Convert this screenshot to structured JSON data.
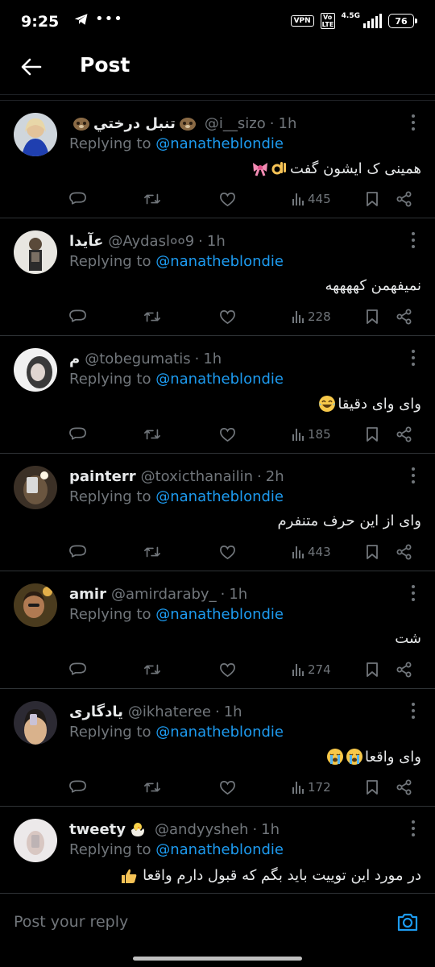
{
  "status_bar": {
    "time": "9:25",
    "vpn": "VPN",
    "network": "4.5G",
    "volte": "Vo LTE",
    "battery": "76"
  },
  "header": {
    "title": "Post"
  },
  "replying_to_prefix": "Replying to",
  "replies": [
    {
      "display_name": "تنبل درختي",
      "handle": "@i__sizo",
      "time": "1h",
      "replying_to": "@nanatheblondie",
      "text": "همینی ک ایشون گفت",
      "views": "445",
      "emoji_before_name": "sloth-emoji",
      "emoji_after_name": "sloth-emoji",
      "text_emojis": [
        "ok-hand-emoji",
        "ribbon-emoji"
      ]
    },
    {
      "display_name": "عآیدا",
      "handle": "@Aydasl००9",
      "time": "1h",
      "replying_to": "@nanatheblondie",
      "text": "نميفهمن کههههه",
      "views": "228"
    },
    {
      "display_name": "م",
      "handle": "@tobegumatis",
      "time": "1h",
      "replying_to": "@nanatheblondie",
      "text": "وای وای دقیقا",
      "views": "185",
      "text_emojis": [
        "laughing-tears-emoji"
      ]
    },
    {
      "display_name": "painterr",
      "handle": "@toxicthanailin",
      "time": "2h",
      "replying_to": "@nanatheblondie",
      "text": "وای از این حرف متنفرم",
      "views": "443"
    },
    {
      "display_name": "amir",
      "handle": "@amirdaraby_",
      "time": "1h",
      "replying_to": "@nanatheblondie",
      "text": "شت",
      "views": "274"
    },
    {
      "display_name": "یادگاری",
      "handle": "@ikhateree",
      "time": "1h",
      "replying_to": "@nanatheblondie",
      "text": "وای واقعا",
      "views": "172",
      "text_emojis": [
        "crying-emoji",
        "crying-emoji"
      ]
    },
    {
      "display_name": "tweety",
      "handle": "@andyysheh",
      "time": "1h",
      "replying_to": "@nanatheblondie",
      "text": "در مورد این توییت باید بگم که قبول دارم واقعا",
      "text_emojis": [
        "thumbs-up-emoji"
      ],
      "emoji_after_name": "hatching-chick-emoji"
    }
  ],
  "reply_bar": {
    "placeholder": "Post your reply"
  },
  "colors": {
    "background": "#000000",
    "link_blue": "#1d9bf0",
    "muted_gray": "#71767b",
    "text": "#e7e9ea"
  }
}
